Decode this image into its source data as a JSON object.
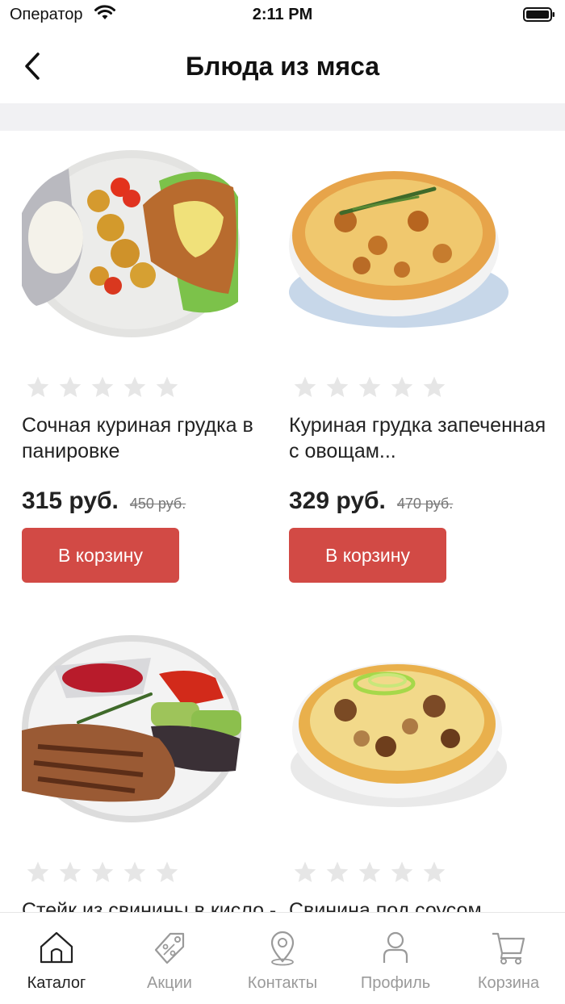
{
  "status_bar": {
    "carrier": "Оператор",
    "time": "2:11 PM"
  },
  "nav": {
    "title": "Блюда из мяса",
    "back_icon": "chevron-left-icon"
  },
  "products": [
    {
      "name": "Сочная куриная грудка в панировке",
      "rating": 0,
      "price": "315 руб.",
      "old_price": "450 руб.",
      "button": "В корзину"
    },
    {
      "name": "Куриная грудка запеченная с овощам...",
      "rating": 0,
      "price": "329 руб.",
      "old_price": "470 руб.",
      "button": "В корзину"
    },
    {
      "name": "Стейк из свинины в кисло - сладком соусе",
      "rating": 0,
      "price": "",
      "old_price": "",
      "button": ""
    },
    {
      "name": "Свинина под соусом \"Карце-Францезе\"",
      "rating": 0,
      "price": "",
      "old_price": "",
      "button": ""
    }
  ],
  "tabs": [
    {
      "label": "Каталог",
      "icon": "home-icon",
      "active": true
    },
    {
      "label": "Акции",
      "icon": "tag-icon",
      "active": false
    },
    {
      "label": "Контакты",
      "icon": "map-pin-icon",
      "active": false
    },
    {
      "label": "Профиль",
      "icon": "user-icon",
      "active": false
    },
    {
      "label": "Корзина",
      "icon": "cart-icon",
      "active": false
    }
  ],
  "colors": {
    "accent": "#d24a45",
    "star_empty": "#e6e6e6",
    "divider": "#f1f1f3",
    "tab_inactive": "#9a9a9a"
  }
}
